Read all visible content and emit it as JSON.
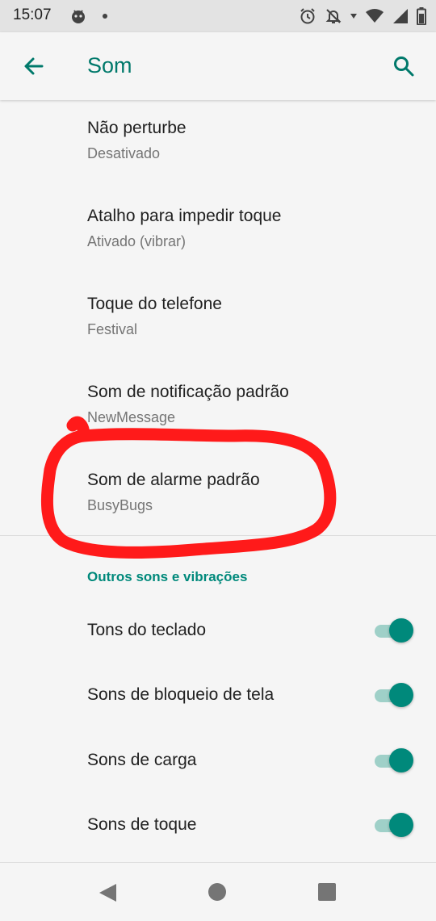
{
  "status_bar": {
    "time": "15:07",
    "icons": [
      "bug-icon",
      "dot-icon",
      "alarm-icon",
      "notifications-off-icon",
      "wifi-icon",
      "signal-icon",
      "battery-icon"
    ]
  },
  "app_bar": {
    "title": "Som",
    "back_icon": "arrow-back-icon",
    "search_icon": "search-icon"
  },
  "preferences": [
    {
      "title": "Não perturbe",
      "summary": "Desativado"
    },
    {
      "title": "Atalho para impedir toque",
      "summary": "Ativado (vibrar)"
    },
    {
      "title": "Toque do telefone",
      "summary": "Festival"
    },
    {
      "title": "Som de notificação padrão",
      "summary": "NewMessage"
    },
    {
      "title": "Som de alarme padrão",
      "summary": "BusyBugs"
    }
  ],
  "section": {
    "header": "Outros sons e vibrações",
    "switches": [
      {
        "label": "Tons do teclado",
        "on": true
      },
      {
        "label": "Sons de bloqueio de tela",
        "on": true
      },
      {
        "label": "Sons de carga",
        "on": true
      },
      {
        "label": "Sons de toque",
        "on": true
      }
    ]
  },
  "colors": {
    "accent": "#00796b",
    "switch_thumb": "#00897b",
    "switch_track": "#9fd0c8",
    "annotation": "#ff1a1a"
  }
}
